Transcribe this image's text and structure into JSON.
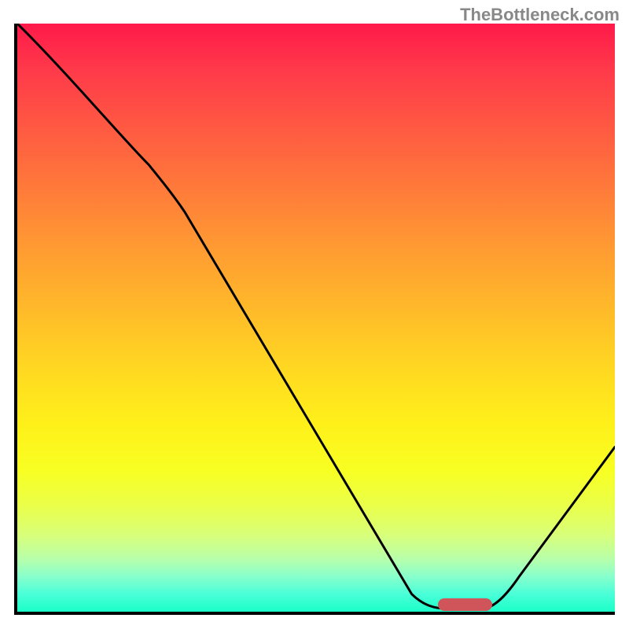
{
  "watermark": "TheBottleneck.com",
  "chart_data": {
    "type": "line",
    "title": "",
    "xlabel": "",
    "ylabel": "",
    "xlim": [
      0,
      100
    ],
    "ylim": [
      0,
      100
    ],
    "series": [
      {
        "name": "curve",
        "points": [
          {
            "x": 0,
            "y": 100
          },
          {
            "x": 22,
            "y": 76
          },
          {
            "x": 25,
            "y": 72
          },
          {
            "x": 66,
            "y": 3
          },
          {
            "x": 70,
            "y": 0.5
          },
          {
            "x": 78,
            "y": 0.5
          },
          {
            "x": 82,
            "y": 3
          },
          {
            "x": 100,
            "y": 28
          }
        ]
      }
    ],
    "marker": {
      "x_start": 70,
      "x_end": 79,
      "y": 1.2,
      "color": "#d0555a"
    },
    "gradient": {
      "direction": "vertical",
      "stops": [
        {
          "pos": 0,
          "color": "#ff1a4a"
        },
        {
          "pos": 50,
          "color": "#ffc822"
        },
        {
          "pos": 80,
          "color": "#f0ff3a"
        },
        {
          "pos": 100,
          "color": "#1affc8"
        }
      ]
    }
  }
}
